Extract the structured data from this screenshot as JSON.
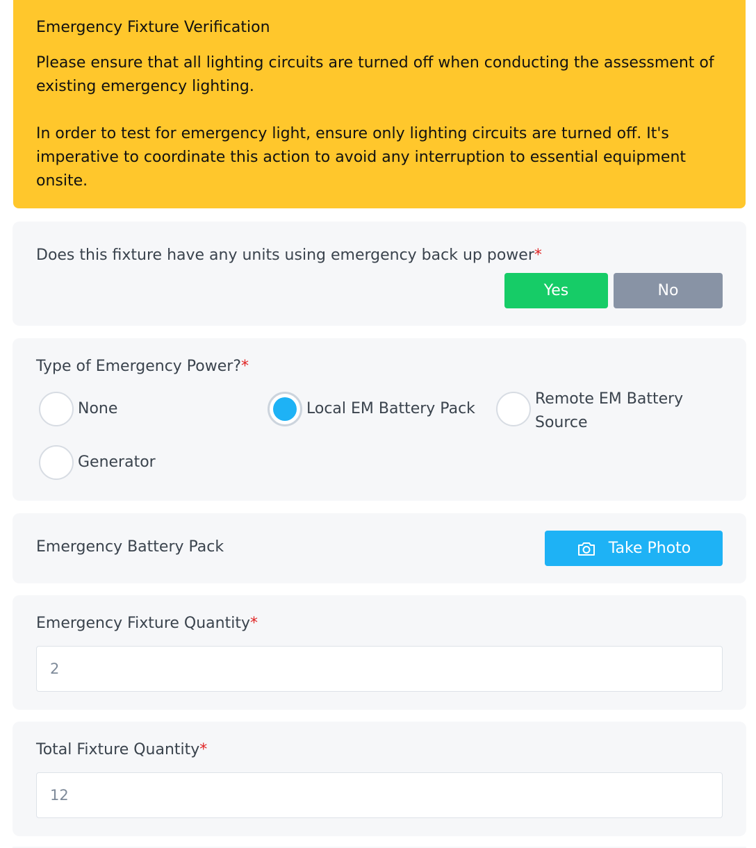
{
  "notice": {
    "title": "Emergency Fixture Verification",
    "paragraph1": "Please ensure that all lighting circuits are turned off when conducting the assessment of existing emergency lighting.",
    "paragraph2": "In order to test for emergency light, ensure only lighting circuits are turned off. It's imperative to coordinate this action to avoid any interruption to essential equipment onsite.",
    "color": "#ffc72c"
  },
  "backup_power": {
    "question": "Does this fixture have any units using emergency back up power",
    "required_mark": "*",
    "yes_label": "Yes",
    "no_label": "No",
    "selected": "Yes",
    "yes_color": "#16cc67",
    "no_color": "#8893a5"
  },
  "power_type": {
    "question": "Type of Emergency Power?",
    "required_mark": "*",
    "options": [
      {
        "label": "None",
        "checked": false
      },
      {
        "label": "Local EM Battery Pack",
        "checked": true
      },
      {
        "label": "Remote EM Battery Source",
        "checked": false
      },
      {
        "label": "Generator",
        "checked": false
      }
    ],
    "accent_color": "#1eb2f5"
  },
  "battery_pack": {
    "label": "Emergency Battery Pack",
    "photo_button_label": "Take Photo",
    "photo_icon": "camera-icon"
  },
  "emergency_quantity": {
    "label": "Emergency Fixture Quantity",
    "required_mark": "*",
    "value": "2"
  },
  "total_quantity": {
    "label": "Total Fixture Quantity",
    "required_mark": "*",
    "value": "12"
  }
}
